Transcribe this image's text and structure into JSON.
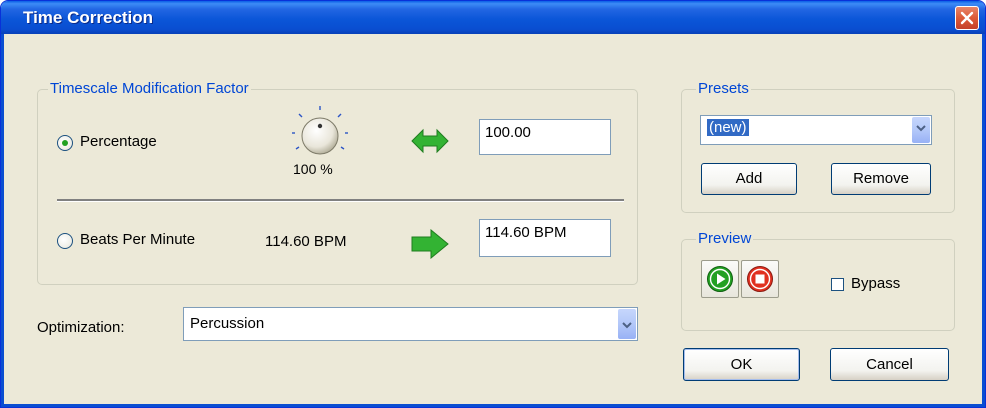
{
  "window": {
    "title": "Time Correction"
  },
  "timescale": {
    "legend": "Timescale Modification Factor",
    "percentage": {
      "label": "Percentage",
      "selected": true,
      "knob_label": "100 %",
      "value": "100.00"
    },
    "bpm": {
      "label": "Beats Per Minute",
      "selected": false,
      "readout": "114.60 BPM",
      "value": "114.60 BPM"
    }
  },
  "optimization": {
    "label": "Optimization:",
    "value": "Percussion"
  },
  "presets": {
    "legend": "Presets",
    "value": "(new)",
    "add_label": "Add",
    "remove_label": "Remove"
  },
  "preview": {
    "legend": "Preview",
    "bypass_label": "Bypass",
    "bypass_checked": false
  },
  "dialog": {
    "ok_label": "OK",
    "cancel_label": "Cancel"
  },
  "icons": {
    "close": "close-icon",
    "link": "double-arrow-icon",
    "arrow": "right-arrow-icon",
    "knob": "knob-icon",
    "play": "play-icon",
    "stop": "stop-icon",
    "dropdown": "chevron-down-icon"
  },
  "colors": {
    "titlebar": "#0a4ed1",
    "legend_text": "#0046d5",
    "arrow_green": "#33b333",
    "close_red": "#dd5a37",
    "selection": "#316ac5"
  }
}
